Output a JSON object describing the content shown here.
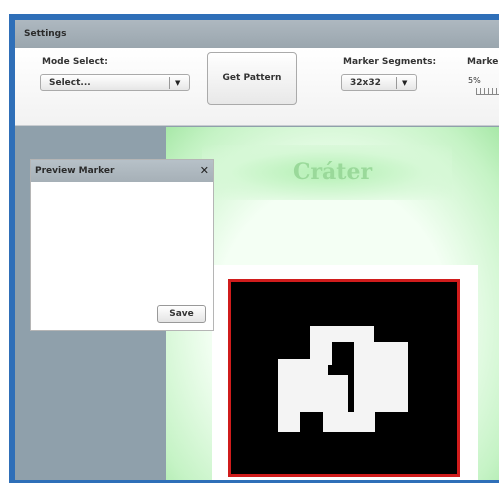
{
  "settings": {
    "title": "Settings",
    "mode_select": {
      "label": "Mode Select:",
      "value": "Select..."
    },
    "get_pattern_label": "Get Pattern",
    "marker_segments": {
      "label": "Marker Segments:",
      "value": "32x32"
    },
    "marker_size": {
      "label": "Marke",
      "value_text": "5%",
      "value": 0.05
    }
  },
  "preview": {
    "title": "Preview Marker",
    "close_icon": "close-icon",
    "save_label": "Save"
  },
  "main": {
    "title": "Cráter"
  },
  "colors": {
    "frame": "#2f6fb8",
    "marker_border": "#d01c1c",
    "title": "#9ad99a"
  }
}
